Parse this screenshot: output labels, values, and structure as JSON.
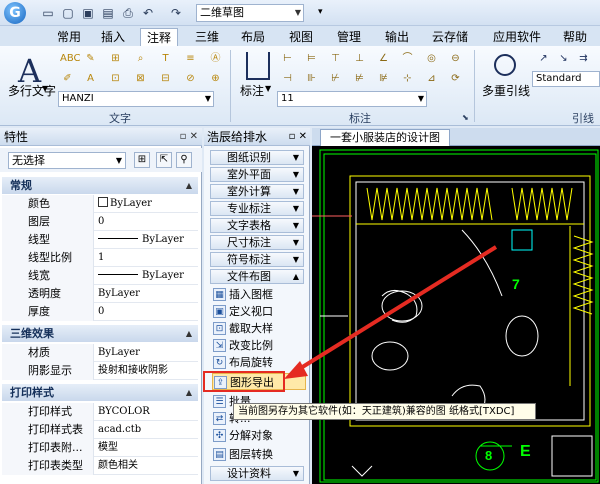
{
  "app": {
    "logo_letter": "G",
    "drawing_selector": "二维草图"
  },
  "quick_access": [
    "new-file-icon",
    "open-file-icon",
    "save-icon",
    "save-as-icon",
    "print-icon",
    "undo-icon",
    "redo-icon"
  ],
  "menu_tabs": [
    {
      "label": "常用"
    },
    {
      "label": "插入"
    },
    {
      "label": "注释",
      "active": true
    },
    {
      "label": "三维"
    },
    {
      "label": "布局"
    },
    {
      "label": "视图"
    },
    {
      "label": "管理"
    },
    {
      "label": "输出"
    },
    {
      "label": "云存储"
    },
    {
      "label": "应用软件"
    },
    {
      "label": "帮助"
    }
  ],
  "ribbon": {
    "text_group": {
      "title": "文字",
      "big_button": "多行文字",
      "font_combo": "HANZI",
      "small_labels": [
        "ABC",
        "A",
        "T"
      ]
    },
    "dim_group": {
      "title": "标注",
      "big_button": "标注",
      "size_combo": "11"
    },
    "leader_group": {
      "title": "引线",
      "big_button": "多重引线",
      "style_combo": "Standard"
    }
  },
  "properties": {
    "title": "特性",
    "selection": "无选择",
    "sections": [
      {
        "title": "常规",
        "rows": [
          {
            "key": "颜色",
            "value": "ByLayer"
          },
          {
            "key": "图层",
            "value": "0"
          },
          {
            "key": "线型",
            "value": "ByLayer"
          },
          {
            "key": "线型比例",
            "value": "1"
          },
          {
            "key": "线宽",
            "value": "ByLayer"
          },
          {
            "key": "透明度",
            "value": "ByLayer"
          },
          {
            "key": "厚度",
            "value": "0"
          }
        ]
      },
      {
        "title": "三维效果",
        "rows": [
          {
            "key": "材质",
            "value": "ByLayer"
          },
          {
            "key": "阴影显示",
            "value": "投射和接收阴影"
          }
        ]
      },
      {
        "title": "打印样式",
        "rows": [
          {
            "key": "打印样式",
            "value": "BYCOLOR"
          },
          {
            "key": "打印样式表",
            "value": "acad.ctb"
          },
          {
            "key": "打印表附...",
            "value": "模型"
          },
          {
            "key": "打印表类型",
            "value": "颜色相关"
          }
        ]
      }
    ]
  },
  "tool_panel": {
    "title": "浩辰给排水",
    "categories_top": [
      "图纸识别",
      "室外平面",
      "室外计算",
      "专业标注",
      "文字表格",
      "尺寸标注",
      "符号标注",
      "文件布图"
    ],
    "tools": [
      {
        "label": "插入图框",
        "icon": "frame-icon"
      },
      {
        "label": "定义视口",
        "icon": "viewport-icon"
      },
      {
        "label": "截取大样",
        "icon": "crop-icon"
      },
      {
        "label": "改变比例",
        "icon": "scale-icon"
      },
      {
        "label": "布局旋转",
        "icon": "rotate-icon"
      },
      {
        "label": "图形导出",
        "icon": "export-icon"
      },
      {
        "label": "批量...",
        "icon": "batch-icon"
      },
      {
        "label": "转...",
        "icon": "convert-icon"
      },
      {
        "label": "分解对象",
        "icon": "explode-icon"
      },
      {
        "label": "图层转换",
        "icon": "layer-convert-icon"
      }
    ],
    "categories_bottom": [
      "设计资料"
    ],
    "tooltip": "当前图另存为其它软件(如：天正建筑)兼容的图  纸格式[TXDC]"
  },
  "drawing": {
    "tab": "一套小服装店的设计图",
    "labels": [
      "7",
      "8",
      "E"
    ]
  },
  "colors": {
    "accent": "#e52b22",
    "canvas": "#000000",
    "cad_yellow": "#ffff00",
    "cad_green": "#00ff00"
  }
}
